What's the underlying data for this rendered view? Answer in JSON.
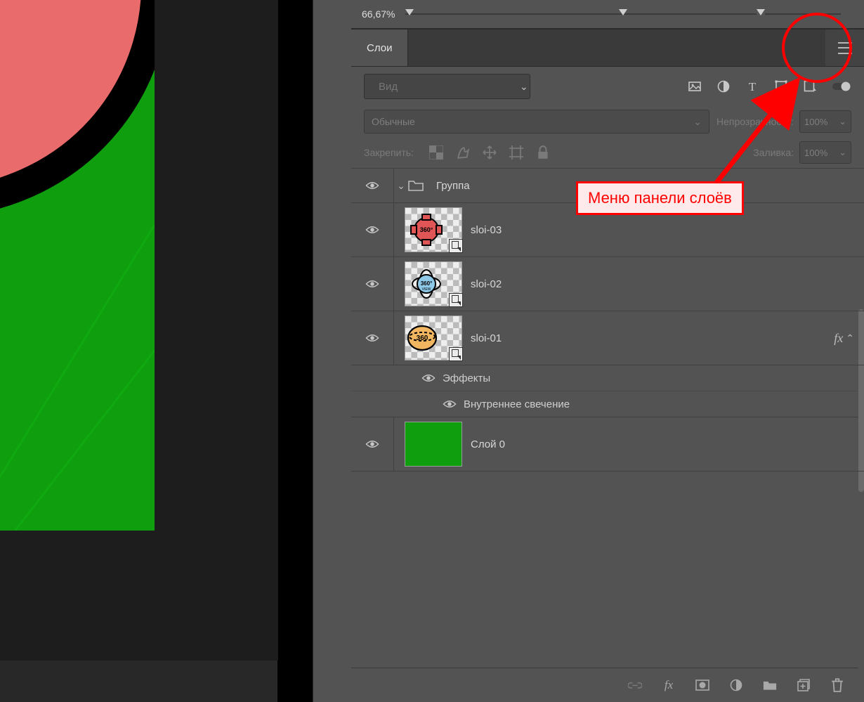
{
  "zoom_label": "66,67%",
  "panel": {
    "tab": "Слои"
  },
  "search": {
    "placeholder": "Вид",
    "value": ""
  },
  "filters": {
    "image": "image-filter-icon",
    "adjust": "adjustment-filter-icon",
    "type": "type-filter-icon",
    "shape": "shape-filter-icon",
    "smart": "smartobject-filter-icon"
  },
  "blend": {
    "mode_label": "Обычные",
    "opacity_label": "Непрозрачность:",
    "opacity_value": "100%"
  },
  "lock": {
    "label": "Закрепить:",
    "fill_label": "Заливка:",
    "fill_value": "100%"
  },
  "group": {
    "name": "Группа"
  },
  "layers": [
    {
      "name": "sloi-03",
      "thumb": "red360"
    },
    {
      "name": "sloi-02",
      "thumb": "blue360"
    },
    {
      "name": "sloi-01",
      "thumb": "orange360",
      "fx": true
    }
  ],
  "effects_label": "Эффекты",
  "effect_item": "Внутреннее свечение",
  "bg_layer": "Слой 0",
  "annotation": "Меню панели слоёв"
}
